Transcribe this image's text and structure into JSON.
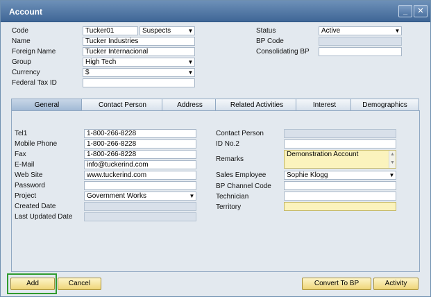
{
  "window": {
    "title": "Account",
    "minimize_label": "_",
    "close_label": "✕"
  },
  "header_left": {
    "code_label": "Code",
    "code_value": "Tucker01",
    "code_type": "Suspects",
    "name_label": "Name",
    "name_value": "Tucker Industries",
    "foreign_name_label": "Foreign Name",
    "foreign_name_value": "Tucker Internacional",
    "group_label": "Group",
    "group_value": "High Tech",
    "currency_label": "Currency",
    "currency_value": "$",
    "federal_tax_label": "Federal Tax ID",
    "federal_tax_value": ""
  },
  "header_right": {
    "status_label": "Status",
    "status_value": "Active",
    "bp_code_label": "BP Code",
    "bp_code_value": "",
    "consolidating_bp_label": "Consolidating BP",
    "consolidating_bp_value": ""
  },
  "tabs": [
    {
      "label": "General",
      "active": true
    },
    {
      "label": "Contact Person",
      "active": false
    },
    {
      "label": "Address",
      "active": false
    },
    {
      "label": "Related Activities",
      "active": false
    },
    {
      "label": "Interest",
      "active": false
    },
    {
      "label": "Demographics",
      "active": false
    }
  ],
  "general_left": {
    "tel1_label": "Tel1",
    "tel1_value": "1-800-266-8228",
    "mobile_label": "Mobile Phone",
    "mobile_value": "1-800-266-8228",
    "fax_label": "Fax",
    "fax_value": "1-800-266-8228",
    "email_label": "E-Mail",
    "email_value": "info@tuckerind.com",
    "website_label": "Web Site",
    "website_value": "www.tuckerind.com",
    "password_label": "Password",
    "password_value": "",
    "project_label": "Project",
    "project_value": "Government Works",
    "created_label": "Created Date",
    "created_value": "",
    "updated_label": "Last Updated Date",
    "updated_value": ""
  },
  "general_right": {
    "contact_person_label": "Contact Person",
    "contact_person_value": "",
    "id_no2_label": "ID No.2",
    "id_no2_value": "",
    "remarks_label": "Remarks",
    "remarks_value": "Demonstration Account",
    "sales_employee_label": "Sales Employee",
    "sales_employee_value": "Sophie Klogg",
    "bp_channel_label": "BP Channel Code",
    "bp_channel_value": "",
    "technician_label": "Technician",
    "technician_value": "",
    "territory_label": "Territory",
    "territory_value": ""
  },
  "buttons": {
    "add": "Add",
    "cancel": "Cancel",
    "convert": "Convert To BP",
    "activity": "Activity"
  },
  "icons": {
    "dropdown": "▼",
    "scroll_up": "▲",
    "scroll_down": "▼"
  },
  "colors": {
    "titlebar": "#3f6696",
    "button": "#efd679",
    "highlight": "#2f9b2f",
    "yellow_field": "#fbf3bd"
  }
}
